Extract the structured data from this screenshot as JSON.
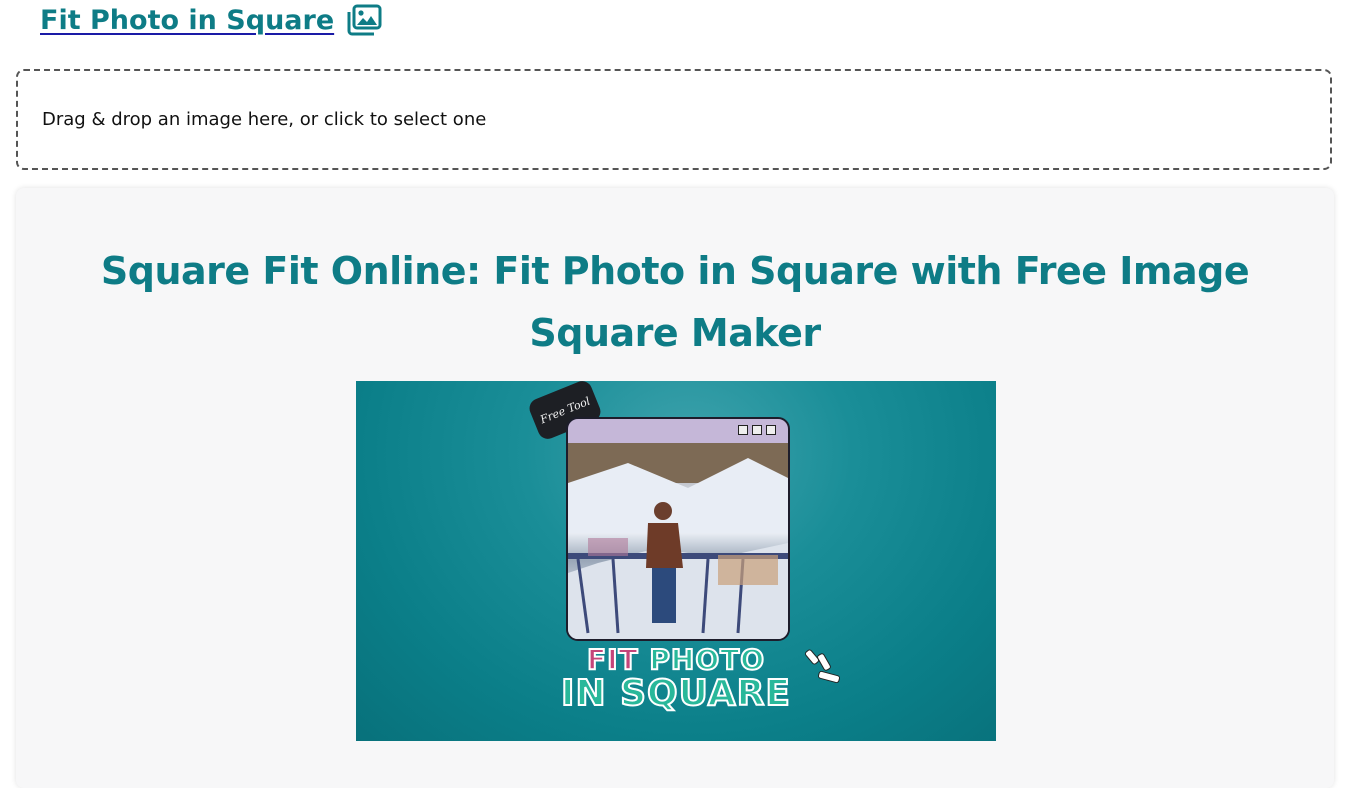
{
  "header": {
    "title": "Fit Photo in Square",
    "icon": "images-icon"
  },
  "dropzone": {
    "label": "Drag & drop an image here, or click to select one"
  },
  "content": {
    "heading": "Square Fit Online: Fit Photo in Square with Free Image Square Maker"
  },
  "banner": {
    "badge": "Free Tool",
    "title_fit": "FIT",
    "title_photo": "PHOTO",
    "title_line2": "IN SQUARE"
  },
  "colors": {
    "accent": "#0e7c86",
    "banner_bg": "#0b7f89",
    "pink": "#c4457a",
    "green": "#29b89a"
  }
}
